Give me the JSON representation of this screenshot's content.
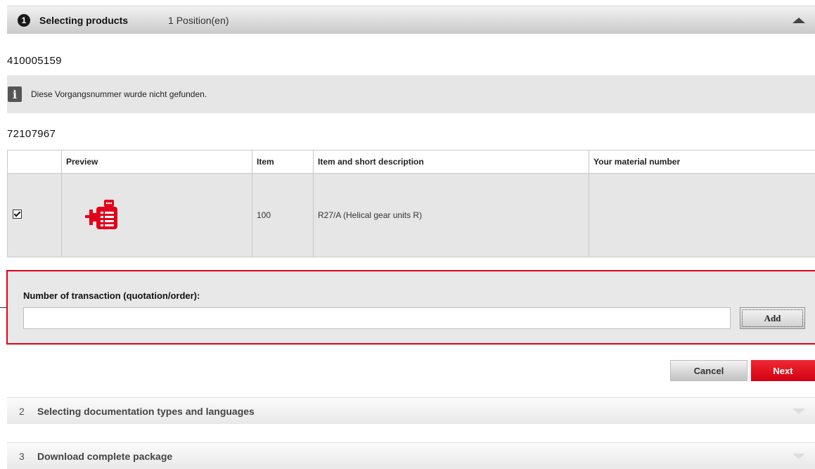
{
  "steps": [
    {
      "number": "1",
      "title": "Selecting products",
      "positions": "1 Position(en)"
    },
    {
      "number": "2",
      "title": "Selecting documentation types and languages"
    },
    {
      "number": "3",
      "title": "Download complete package"
    }
  ],
  "transactions": [
    {
      "number": "410005159",
      "info_message": "Diese Vorgangsnummer wurde nicht gefunden."
    },
    {
      "number": "72107967"
    }
  ],
  "table": {
    "headers": [
      "",
      "Preview",
      "Item",
      "Item and short description",
      "Your material number"
    ],
    "rows": [
      {
        "checked": true,
        "preview_icon": "gear-motor-icon",
        "item": "100",
        "description": "R27/A (Helical gear units R)",
        "material_number": ""
      }
    ]
  },
  "transaction_input": {
    "label": "Number of transaction (quotation/order):",
    "value": "",
    "add_label": "Add"
  },
  "actions": {
    "cancel": "Cancel",
    "next": "Next"
  },
  "colors": {
    "accent": "#e2001a",
    "panel": "#e6e6e6",
    "header_bar": "#c9c9c9"
  }
}
